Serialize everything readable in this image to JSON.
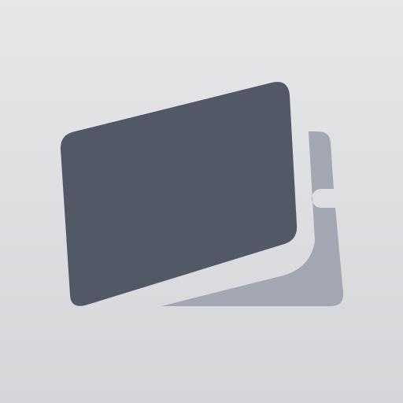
{
  "icon": {
    "name": "stacked-cards-icon",
    "colors": {
      "background_top": "#e6e7e9",
      "background_bottom": "#d5d6d9",
      "front_card": "#525866",
      "back_card": "#a2a7b1"
    }
  }
}
